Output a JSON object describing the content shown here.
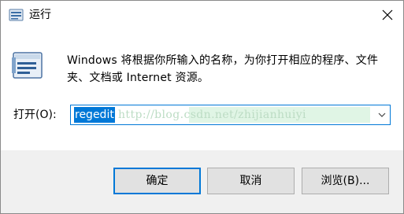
{
  "window": {
    "title": "运行",
    "close_icon": "close-icon",
    "app_icon": "run-dialog-icon"
  },
  "dialog": {
    "description": "Windows 将根据你所输入的名称，为你打开相应的程序、文件夹、文档或 Internet 资源。",
    "big_icon": "run-dialog-large-icon"
  },
  "open_field": {
    "label": "打开(O):",
    "value": "regedit",
    "watermark": "http://blog.csdn.net/zhijianhuiyi",
    "dropdown_icon": "chevron-down-icon"
  },
  "buttons": {
    "ok": "确定",
    "cancel": "取消",
    "browse": "浏览(B)..."
  },
  "colors": {
    "accent": "#0078d7",
    "footer_bg": "#f0f0f0",
    "watermark": "#c7ecd0"
  }
}
